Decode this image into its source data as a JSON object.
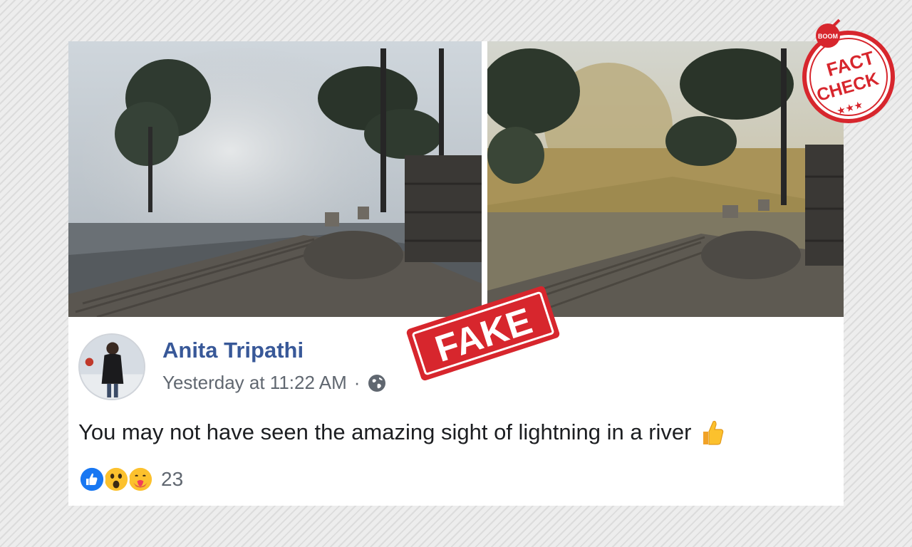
{
  "post": {
    "author_name": "Anita Tripathi",
    "timestamp": "Yesterday at 11:22 AM",
    "separator": "·",
    "privacy_icon": "globe-icon",
    "text": "You may not have seen the amazing sight of lightning in a river",
    "text_emoji": "thumbs-up-icon",
    "reactions": [
      "like-icon",
      "wow-icon",
      "care-icon"
    ],
    "reaction_count": "23"
  },
  "overlay": {
    "fake_stamp_label": "FAKE",
    "fact_check_stamp": {
      "brand": "BOOM",
      "line1": "FACT",
      "line2": "CHECK",
      "stars": "★★★"
    }
  },
  "colors": {
    "author_link": "#385898",
    "meta_text": "#606770",
    "body_text": "#1c1e21",
    "stamp_red": "#d7262d",
    "like_blue": "#1877f2"
  }
}
